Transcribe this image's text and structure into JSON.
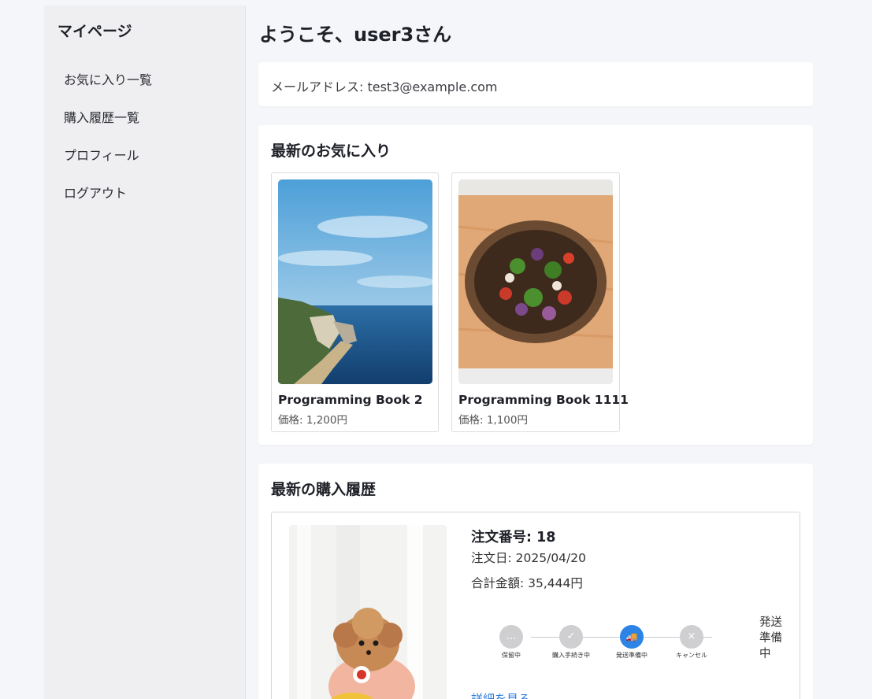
{
  "sidebar": {
    "title": "マイページ",
    "items": [
      {
        "label": "お気に入り一覧"
      },
      {
        "label": "購入履歴一覧"
      },
      {
        "label": "プロフィール"
      },
      {
        "label": "ログアウト"
      }
    ]
  },
  "main": {
    "welcome": "ようこそ、user3さん",
    "email_line": "メールアドレス: test3@example.com",
    "favorites": {
      "title": "最新のお気に入り",
      "items": [
        {
          "name": "Programming Book 2",
          "price": "価格: 1,200円"
        },
        {
          "name": "Programming Book 1111",
          "price": "価格: 1,100円"
        }
      ]
    },
    "orders": {
      "title": "最新の購入履歴",
      "order": {
        "number": "注文番号: 18",
        "date": "注文日: 2025/04/20",
        "total": "合計金額: 35,444円",
        "steps": [
          {
            "label": "保留中",
            "icon": "…"
          },
          {
            "label": "購入手続き中",
            "icon": "✓"
          },
          {
            "label": "発送準備中",
            "icon": "🚚"
          },
          {
            "label": "キャンセル",
            "icon": "×"
          }
        ],
        "status": "発送準備中",
        "detail_link": "詳細を見る"
      }
    }
  },
  "colors": {
    "accent": "#2b84e6",
    "link": "#2b7be0",
    "step_inactive": "#cfcfd1",
    "background": "#f5f6f9"
  }
}
